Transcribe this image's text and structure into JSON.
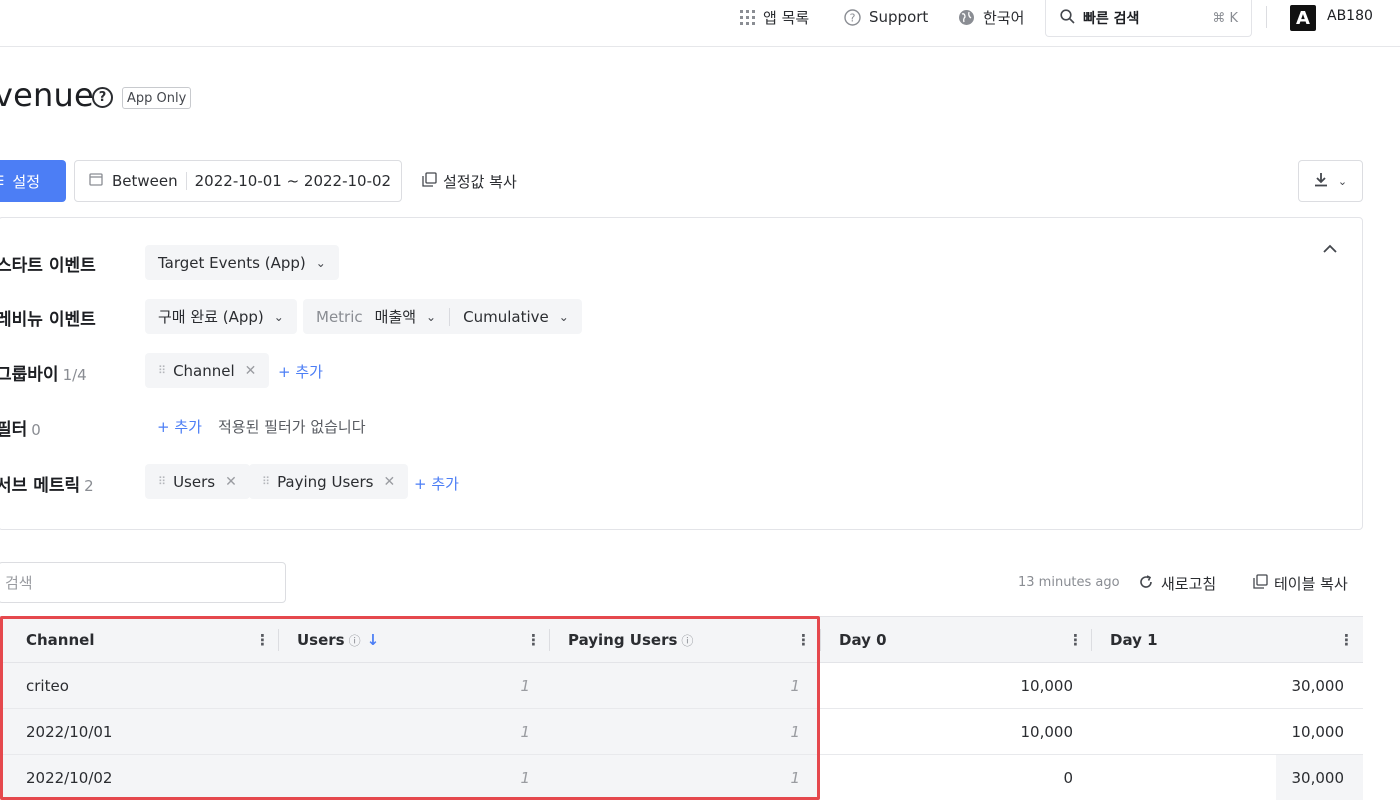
{
  "topbar": {
    "app_list": "앱 목록",
    "support": "Support",
    "language": "한국어",
    "search_label": "빠른 검색",
    "search_shortcut": "⌘ K",
    "logo_letter": "A",
    "org": "AB180"
  },
  "page": {
    "title": "venue",
    "badge": "App Only"
  },
  "toolbar": {
    "settings_label": "설정",
    "date_mode": "Between",
    "date_range": "2022-10-01 ~ 2022-10-02",
    "copy_settings": "설정값 복사"
  },
  "panel": {
    "start_event": {
      "label": "스타트 이벤트",
      "value": "Target Events (App)"
    },
    "revenue_event": {
      "label": "레비뉴 이벤트",
      "value": "구매 완료 (App)",
      "metric_label": "Metric",
      "metric_value": "매출액",
      "mode": "Cumulative"
    },
    "group_by": {
      "label": "그룹바이",
      "count": "1/4",
      "chip": "Channel",
      "add": "+ 추가"
    },
    "filter": {
      "label": "필터",
      "count": "0",
      "add": "+ 추가",
      "empty": "적용된 필터가 없습니다"
    },
    "sub_metric": {
      "label": "서브 메트릭",
      "count": "2",
      "chips": [
        "Users",
        "Paying Users"
      ],
      "add": "+ 추가"
    }
  },
  "table_controls": {
    "search_placeholder": "검색",
    "updated": "13 minutes ago",
    "refresh": "새로고침",
    "copy_table": "테이블 복사"
  },
  "table": {
    "columns": [
      "Channel",
      "Users",
      "Paying Users",
      "Day 0",
      "Day 1"
    ],
    "rows": [
      {
        "channel": "criteo",
        "users": "1",
        "paying": "1",
        "day0": "10,000",
        "day1": "30,000"
      },
      {
        "channel": "2022/10/01",
        "users": "1",
        "paying": "1",
        "day0": "10,000",
        "day1": "10,000"
      },
      {
        "channel": "2022/10/02",
        "users": "1",
        "paying": "1",
        "day0": "0",
        "day1": "30,000"
      }
    ]
  },
  "colors": {
    "accent": "#4c7ef5",
    "highlight": "#e5484d"
  }
}
